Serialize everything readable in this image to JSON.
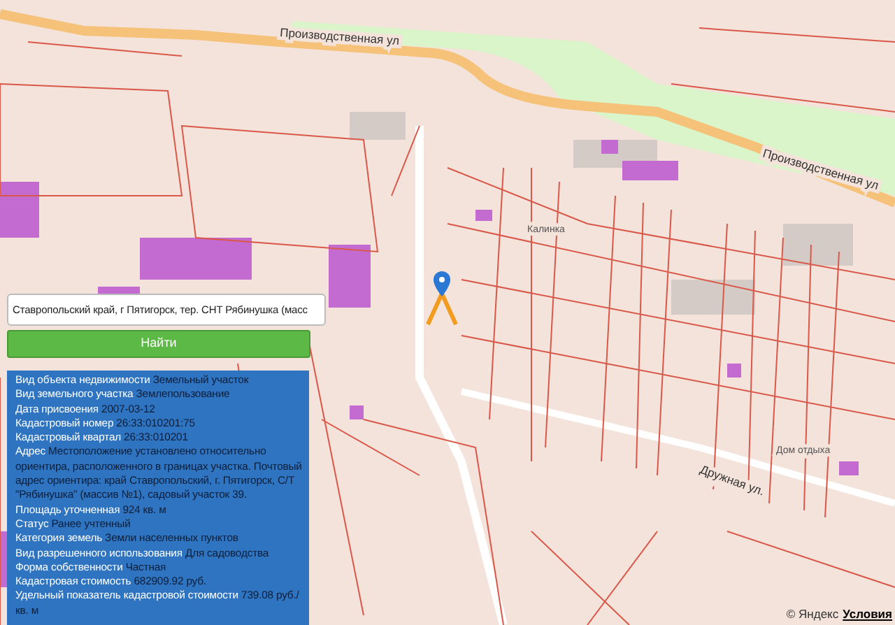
{
  "map_labels": [
    {
      "text": "Производственная ул",
      "kind": "street"
    },
    {
      "text": "Производственная ул",
      "kind": "street"
    },
    {
      "text": "Дружная ул.",
      "kind": "street"
    },
    {
      "text": "Калинка",
      "kind": "place"
    },
    {
      "text": "Дом отдыха",
      "kind": "place"
    }
  ],
  "search": {
    "value": "Ставропольский край, г Пятигорск, тер. СНТ Рябинушка (масс",
    "button": "Найти"
  },
  "info": [
    {
      "label": "Вид объекта недвижимости",
      "value": "Земельный участок"
    },
    {
      "label": "Вид земельного участка",
      "value": "Землепользование"
    },
    {
      "label": "Дата присвоения",
      "value": "2007-03-12"
    },
    {
      "label": "Кадастровый номер",
      "value": "26:33:010201:75"
    },
    {
      "label": "Кадастровый квартал",
      "value": "26:33:010201"
    },
    {
      "label": "Адрес",
      "value": "Местоположение установлено относительно ориентира, расположенного в границах участка. Почтовый адрес ориентира: край Ставропольский, г. Пятигорск, С/Т \"Рябинушка\" (массив №1), садовый участок 39."
    },
    {
      "label": "Площадь уточненная",
      "value": "924 кв. м"
    },
    {
      "label": "Статус",
      "value": "Ранее учтенный"
    },
    {
      "label": "Категория земель",
      "value": "Земли населенных пунктов"
    },
    {
      "label": "Вид разрешенного использования",
      "value": "Для садоводства"
    },
    {
      "label": "Форма собственности",
      "value": "Частная"
    },
    {
      "label": "Кадастровая стоимость",
      "value": "682909.92 руб."
    },
    {
      "label": "Удельный показатель кадастровой стоимости",
      "value": "739.08 руб./кв. м"
    }
  ],
  "attribution": {
    "brand": "© Яндекс",
    "link": "Условия"
  }
}
